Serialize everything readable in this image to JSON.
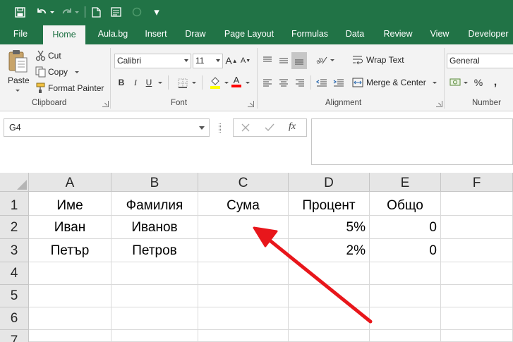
{
  "quick_access": {
    "more_label": "▾"
  },
  "tabs": [
    {
      "label": "File"
    },
    {
      "label": "Home",
      "active": true
    },
    {
      "label": "Aula.bg"
    },
    {
      "label": "Insert"
    },
    {
      "label": "Draw"
    },
    {
      "label": "Page Layout"
    },
    {
      "label": "Formulas"
    },
    {
      "label": "Data"
    },
    {
      "label": "Review"
    },
    {
      "label": "View"
    },
    {
      "label": "Developer"
    }
  ],
  "ribbon": {
    "clipboard": {
      "paste": "Paste",
      "cut": "Cut",
      "copy": "Copy",
      "format_painter": "Format Painter",
      "group": "Clipboard"
    },
    "font": {
      "font_name": "Calibri",
      "font_size": "11",
      "bold": "B",
      "italic": "I",
      "underline": "U",
      "grow": "A",
      "shrink": "A",
      "font_color_letter": "A",
      "group": "Font"
    },
    "alignment": {
      "wrap_text": "Wrap Text",
      "merge_center": "Merge & Center",
      "group": "Alignment"
    },
    "number": {
      "format": "General",
      "percent": "%",
      "comma": ",",
      "group": "Number"
    }
  },
  "formula_bar": {
    "name_box": "G4",
    "fx": "fx",
    "formula": ""
  },
  "sheet": {
    "columns": [
      "A",
      "B",
      "C",
      "D",
      "E",
      "F"
    ],
    "rows": [
      "1",
      "2",
      "3",
      "4",
      "5",
      "6",
      "7"
    ],
    "cells": {
      "A1": "Име",
      "B1": "Фамилия",
      "C1": "Сума",
      "D1": "Процент",
      "E1": "Общо",
      "A2": "Иван",
      "B2": "Иванов",
      "D2": "5%",
      "E2": "0",
      "A3": "Петър",
      "B3": "Петров",
      "D3": "2%",
      "E3": "0"
    }
  },
  "colors": {
    "excel_green": "#217346",
    "ribbon_bg": "#f3f3f3",
    "annotation_arrow": "#e8161b",
    "fill_yellow": "#ffff00",
    "font_red": "#ff0000"
  }
}
